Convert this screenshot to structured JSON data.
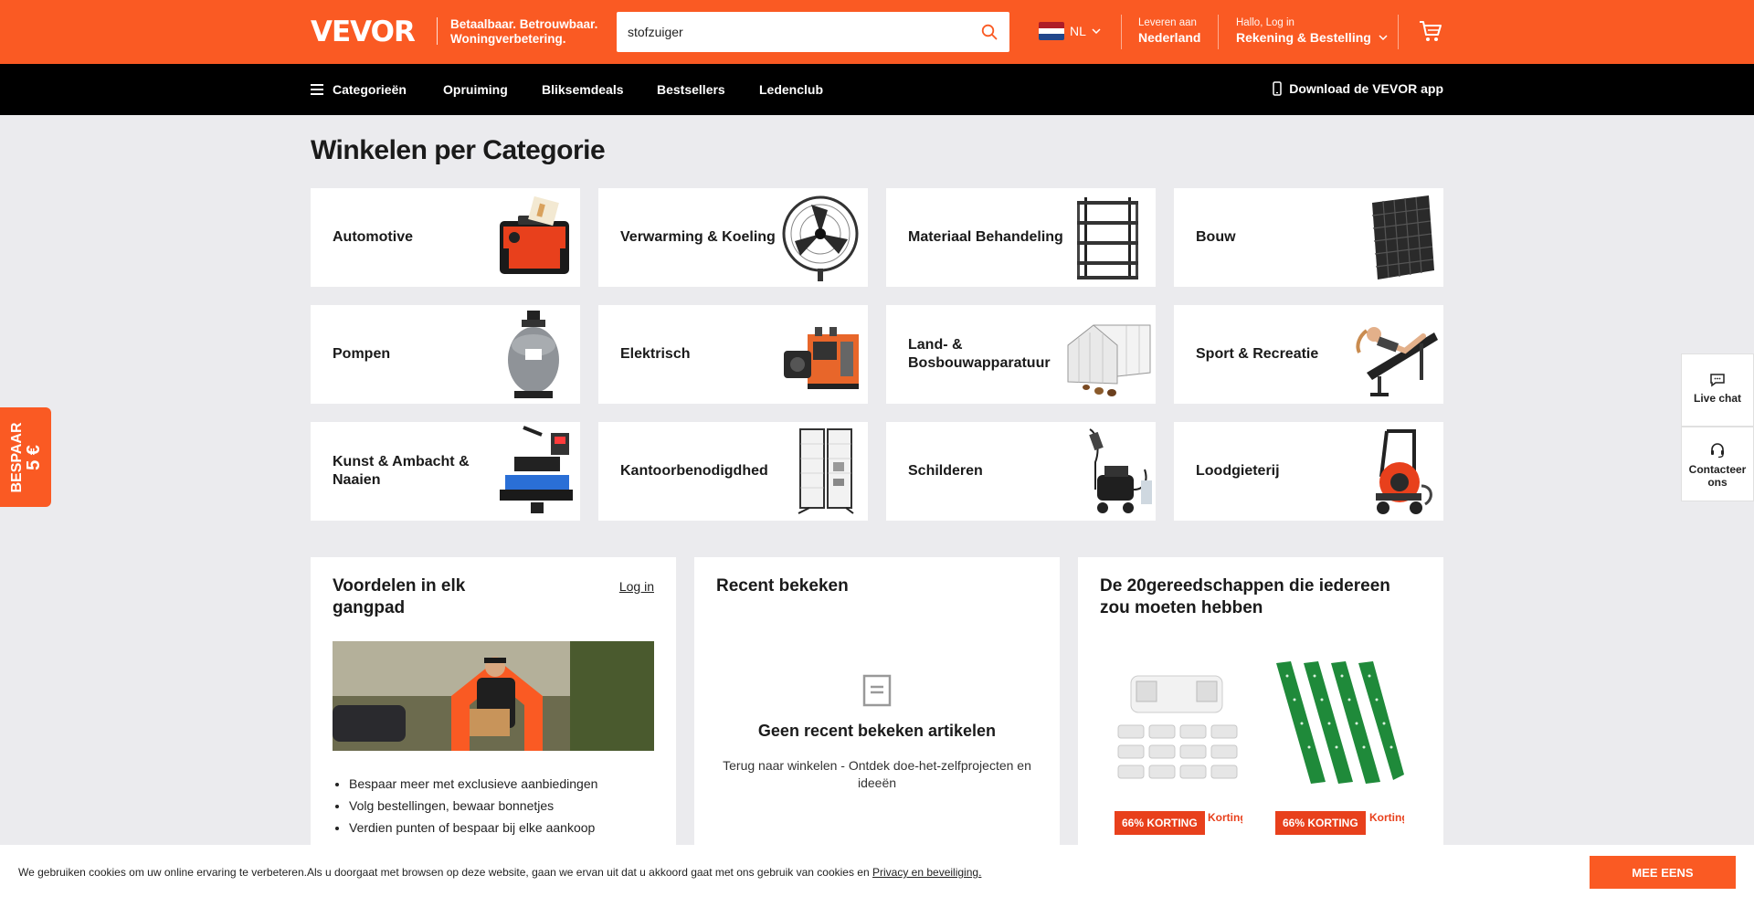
{
  "header": {
    "logo": "VEVOR",
    "tagline_line1": "Betaalbaar. Betrouwbaar.",
    "tagline_line2": "Woningverbetering.",
    "search_value": "stofzuiger",
    "language": "NL",
    "deliver_label": "Leveren aan",
    "deliver_country": "Nederland",
    "account_greeting": "Hallo, Log in",
    "account_label": "Rekening & Bestelling",
    "brand_color": "#fa5a23"
  },
  "nav": {
    "categories": "Categorieën",
    "items": [
      "Opruiming",
      "Bliksemdeals",
      "Bestsellers",
      "Ledenclub"
    ],
    "app_download": "Download de VEVOR app"
  },
  "main": {
    "title": "Winkelen per Categorie",
    "categories": [
      {
        "label": "Automotive",
        "icon": "toolbox-icon"
      },
      {
        "label": "Verwarming & Koeling",
        "icon": "fan-icon"
      },
      {
        "label": "Materiaal Behandeling",
        "icon": "shelving-icon"
      },
      {
        "label": "Bouw",
        "icon": "grid-tile-icon"
      },
      {
        "label": "Pompen",
        "icon": "pool-filter-icon"
      },
      {
        "label": "Elektrisch",
        "icon": "wire-stripper-icon"
      },
      {
        "label": "Land- & Bosbouwapparatuur",
        "icon": "chicken-coop-icon"
      },
      {
        "label": "Sport & Recreatie",
        "icon": "bench-icon"
      },
      {
        "label": "Kunst & Ambacht & Naaien",
        "icon": "heat-press-icon"
      },
      {
        "label": "Kantoorbenodigdheden",
        "icon": "display-panel-icon"
      },
      {
        "label": "Schilderen",
        "icon": "paint-sprayer-icon"
      },
      {
        "label": "Loodgieterij",
        "icon": "drain-cleaner-icon"
      }
    ]
  },
  "benefits": {
    "title": "Voordelen in elk gangpad",
    "login": "Log in",
    "items": [
      "Bespaar meer met exclusieve aanbiedingen",
      "Volg bestellingen, bewaar bonnetjes",
      "Verdien punten of bespaar bij elke aankoop"
    ]
  },
  "recent": {
    "title": "Recent bekeken",
    "empty_title": "Geen recent bekeken artikelen",
    "empty_subtitle": "Terug naar winkelen - Ontdek doe-het-zelfprojecten en ideeën"
  },
  "tools": {
    "title": "De 20gereedschappen die iedereen zou moeten hebben",
    "products": [
      {
        "badge": "66% KORTING",
        "sub": "Korting",
        "icon": "emergency-light-icon"
      },
      {
        "badge": "66% KORTING",
        "sub": "Korting",
        "icon": "fence-post-icon"
      }
    ]
  },
  "side_tab": {
    "line1": "BESPAAR",
    "line2": "5 €"
  },
  "widgets": {
    "live_chat": "Live chat",
    "contact": "Contacteer ons"
  },
  "cookie": {
    "text": "We gebruiken cookies om uw online ervaring te verbeteren.Als u doorgaat met browsen op deze website, gaan we ervan uit dat u akkoord gaat met ons gebruik van cookies en",
    "link": "Privacy en beveiliging.",
    "button": "MEE EENS"
  }
}
